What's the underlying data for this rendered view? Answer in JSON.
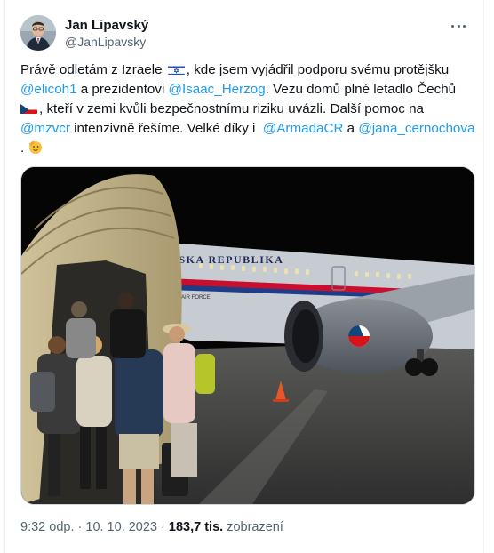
{
  "author": {
    "display_name": "Jan Lipavský",
    "handle": "@JanLipavsky",
    "avatar_icon": "profile-photo",
    "more_icon": "more-horizontal-icon"
  },
  "tweet": {
    "line1_a": "Právě odletám z Izraele ",
    "line1_b": ", kde jsem vyjádřil podporu svému protějšku",
    "mention_elicoh": "@elicoh1",
    "line2_a": " a prezidentovi ",
    "mention_herzog": "@Isaac_Herzog",
    "line2_b": ". Vezu domů plné letadlo Čechů",
    "line3": ", kteří v zemi kvůli bezpečnostnímu riziku uvázli. Další pomoc na",
    "mention_mzv": "@mzvcr",
    "line4_a": " intenzivně řešíme. Velké díky i  ",
    "mention_armada": "@ArmadaCR",
    "line4_b": " a ",
    "mention_cernochova": "@jana_cernochova",
    "line5": ". ",
    "emoji_salute": "🫡"
  },
  "media": {
    "aircraft_text": "ESKA REPUBLIKA",
    "air_force_text": "AIR FORCE",
    "colors": {
      "night": "#050505",
      "tarmac": "#3a3a3a",
      "cone": "#e8552b"
    }
  },
  "meta": {
    "time": "9:32 odp.",
    "separator": " · ",
    "date": "10. 10. 2023",
    "views_count": "183,7 tis.",
    "views_label": " zobrazení"
  },
  "colors": {
    "link": "#1d9bf0",
    "secondary": "#536471",
    "text": "#0f1419"
  }
}
